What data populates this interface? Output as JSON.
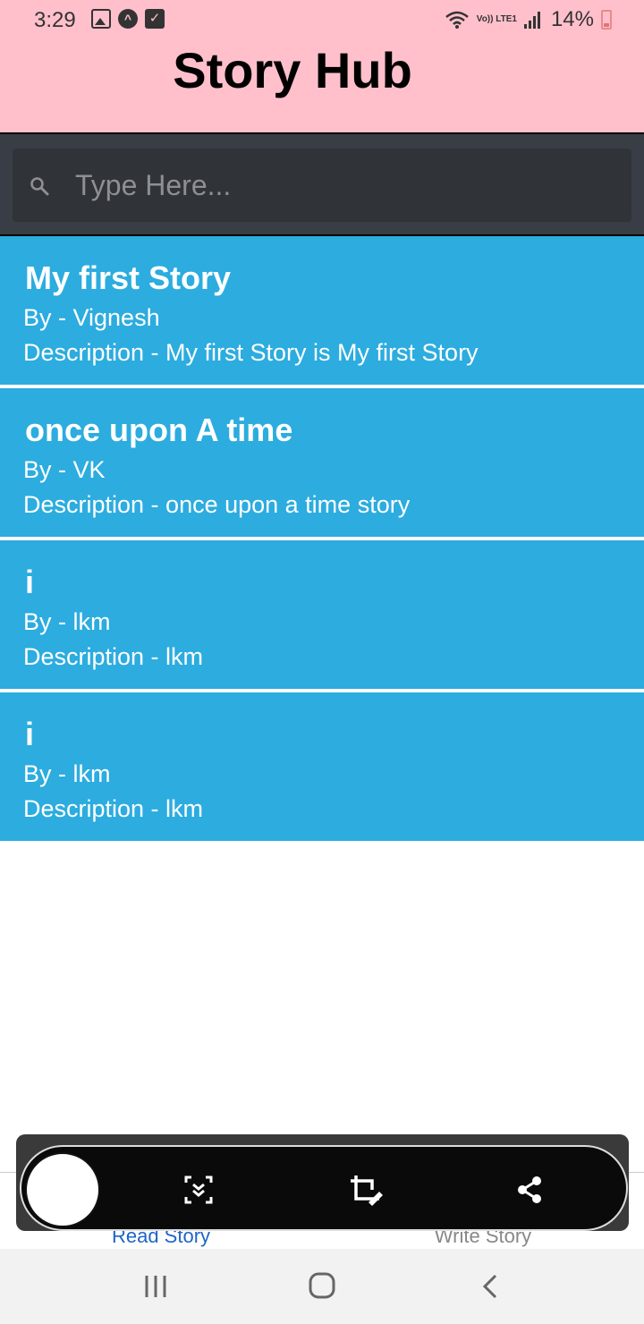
{
  "status_bar": {
    "time": "3:29",
    "network_label": "Vo)) LTE1",
    "battery": "14%"
  },
  "header": {
    "title": "Story Hub"
  },
  "search": {
    "placeholder": "Type Here..."
  },
  "stories": [
    {
      "title": "My first Story",
      "author": "By - Vignesh",
      "description": "Description - My first Story is My first Story"
    },
    {
      "title": "once upon A time",
      "author": "By - VK",
      "description": "Description - once upon a time story"
    },
    {
      "title": "i",
      "author": "By - lkm",
      "description": "Description - lkm"
    },
    {
      "title": "i",
      "author": "By - lkm",
      "description": "Description - lkm"
    }
  ],
  "tabs": {
    "read": "Read Story",
    "write": "Write Story"
  },
  "colors": {
    "header_bg": "#ffc0cb",
    "card_bg": "#2cacdf",
    "search_bg": "#393e46",
    "active_tab": "#2065c7"
  },
  "icons": {
    "search": "search-icon",
    "scroll_capture": "scroll-capture-icon",
    "crop_edit": "crop-edit-icon",
    "share": "share-icon"
  }
}
